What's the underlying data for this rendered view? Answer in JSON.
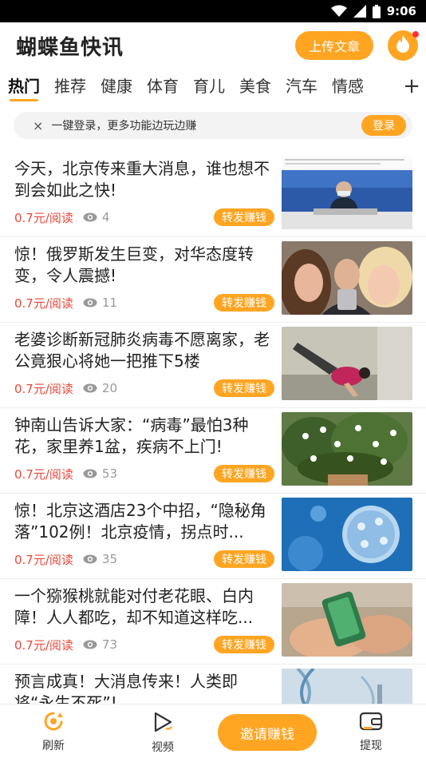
{
  "status_bar": {
    "time": "9:06"
  },
  "header": {
    "app_title": "蝴蝶鱼快讯",
    "upload_label": "上传文章"
  },
  "tabs": [
    "热门",
    "推荐",
    "健康",
    "体育",
    "育儿",
    "美食",
    "汽车",
    "情感"
  ],
  "tab_more": "+",
  "login_banner": {
    "close": "×",
    "text": "一键登录，更多功能边玩边赚",
    "button": "登录"
  },
  "news": [
    {
      "title": "今天，北京传来重大消息，谁也想不到会如此之快!",
      "price": "0.7元/阅读",
      "views": "4",
      "share": "转发赚钱",
      "image": "press-conference"
    },
    {
      "title": "惊！俄罗斯发生巨变，对华态度转变，令人震撼!",
      "price": "0.7元/阅读",
      "views": "11",
      "share": "转发赚钱",
      "image": "selfie-photo"
    },
    {
      "title": "老婆诊断新冠肺炎病毒不愿离家，老公竟狠心将她一把推下5楼",
      "price": "0.7元/阅读",
      "views": "20",
      "share": "转发赚钱",
      "image": "falling-person"
    },
    {
      "title": "钟南山告诉大家：“病毒”最怕3种花，家里养1盆，疾病不上门!",
      "price": "0.7元/阅读",
      "views": "53",
      "share": "转发赚钱",
      "image": "jasmine-plant"
    },
    {
      "title": "惊！北京这酒店23个中招，“隐秘角落”102例！北京疫情，拐点时...",
      "price": "0.7元/阅读",
      "views": "35",
      "share": "转发赚钱",
      "image": "virus-illustration"
    },
    {
      "title": "一个猕猴桃就能对付老花眼、白内障！人人都吃，却不知道这样吃...",
      "price": "0.7元/阅读",
      "views": "73",
      "share": "转发赚钱",
      "image": "phone-in-hands"
    },
    {
      "title": "预言成真！大消息传来！人类即将“永生不死”!",
      "price": "",
      "views": "",
      "share": "",
      "image": "dna-helix"
    }
  ],
  "bottom_nav": {
    "refresh": "刷新",
    "video": "视频",
    "invite": "邀请赚钱",
    "withdraw": "提现"
  },
  "colors": {
    "accent": "#ffa522",
    "price": "#e8493b"
  }
}
